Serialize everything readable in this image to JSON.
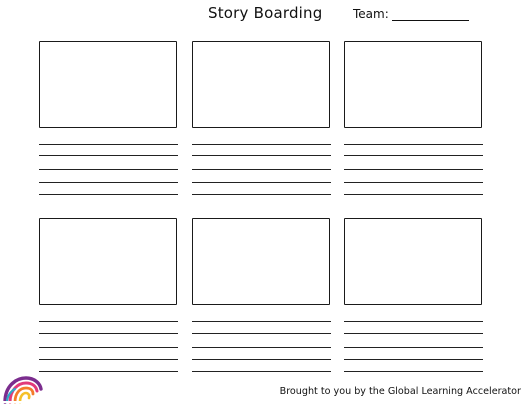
{
  "header": {
    "title": "Story Boarding",
    "team_label": "Team:"
  },
  "footer": {
    "credit": "Brought to you by the Global Learning Accelerator"
  },
  "storyboard": {
    "panel_count": 6,
    "lines_per_panel": 5
  },
  "logo": {
    "icon": "rainbow-arc-logo",
    "colors": [
      "#7b2d8e",
      "#e23a7a",
      "#f47c2a",
      "#f5c02a",
      "#2fa8c8"
    ]
  }
}
